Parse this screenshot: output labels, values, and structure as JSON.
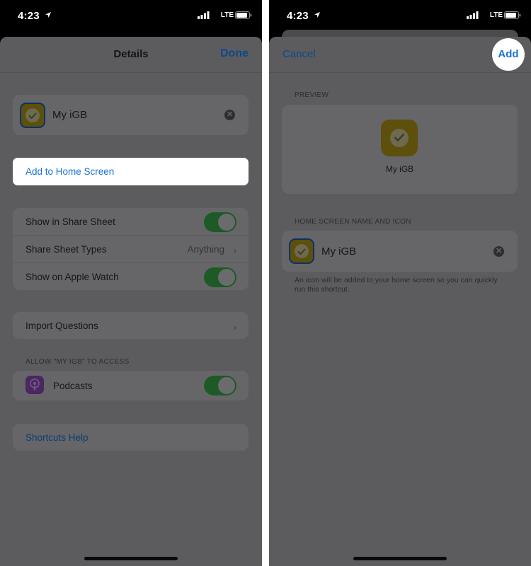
{
  "status_bar": {
    "time": "4:23",
    "network": "LTE"
  },
  "left": {
    "nav": {
      "title": "Details",
      "done_label": "Done"
    },
    "shortcut_name": "My iGB",
    "add_to_home_label": "Add to Home Screen",
    "settings": {
      "show_in_share_sheet": "Show in Share Sheet",
      "share_sheet_types": "Share Sheet Types",
      "share_sheet_types_value": "Anything",
      "show_on_apple_watch": "Show on Apple Watch"
    },
    "import_questions_label": "Import Questions",
    "access_header": "ALLOW \"MY IGB\" TO ACCESS",
    "podcasts_label": "Podcasts",
    "help_label": "Shortcuts Help"
  },
  "right": {
    "nav": {
      "cancel_label": "Cancel",
      "add_label": "Add"
    },
    "preview_header": "PREVIEW",
    "preview_name": "My iGB",
    "name_icon_header": "HOME SCREEN NAME AND ICON",
    "name_value": "My iGB",
    "footnote": "An icon will be added to your home screen so you can quickly run this shortcut."
  },
  "colors": {
    "accent": "#1a73d6",
    "dim_overlay_background": "#5c5c5e",
    "toggle_on": "#1d5a26",
    "icon_yellow": "#5d4f0c"
  }
}
